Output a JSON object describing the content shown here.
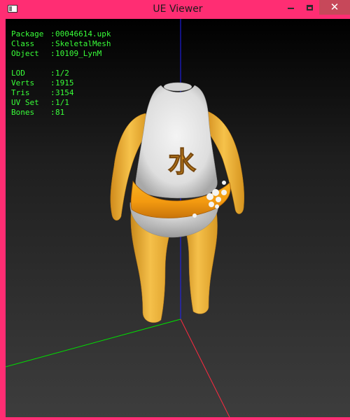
{
  "window": {
    "title": "UE Viewer",
    "frame_color": "#ff2d73",
    "close_hover_color": "#c7485a"
  },
  "info": {
    "package": {
      "label": "Package",
      "value": "00046614.upk"
    },
    "class": {
      "label": "Class",
      "value": "SkeletalMesh"
    },
    "object": {
      "label": "Object",
      "value": "10109_LynM"
    },
    "lod": {
      "label": "LOD",
      "value": "1/2"
    },
    "verts": {
      "label": "Verts",
      "value": "1915"
    },
    "tris": {
      "label": "Tris",
      "value": "3154"
    },
    "uvset": {
      "label": "UV Set",
      "value": "1/1"
    },
    "bones": {
      "label": "Bones",
      "value": "81"
    },
    "text_color": "#39ff39"
  },
  "model": {
    "glyph": "水",
    "body_color": "#f0b030",
    "belt_color": "#f5a010",
    "shirt_color": "#e8e8e8"
  },
  "axes": {
    "x_color": "#ff2a40",
    "y_color": "#00e000",
    "z_color": "#2020ff"
  },
  "icons": {
    "app": "app-icon",
    "minimize": "minimize-icon",
    "maximize": "maximize-icon",
    "close": "close-icon"
  }
}
